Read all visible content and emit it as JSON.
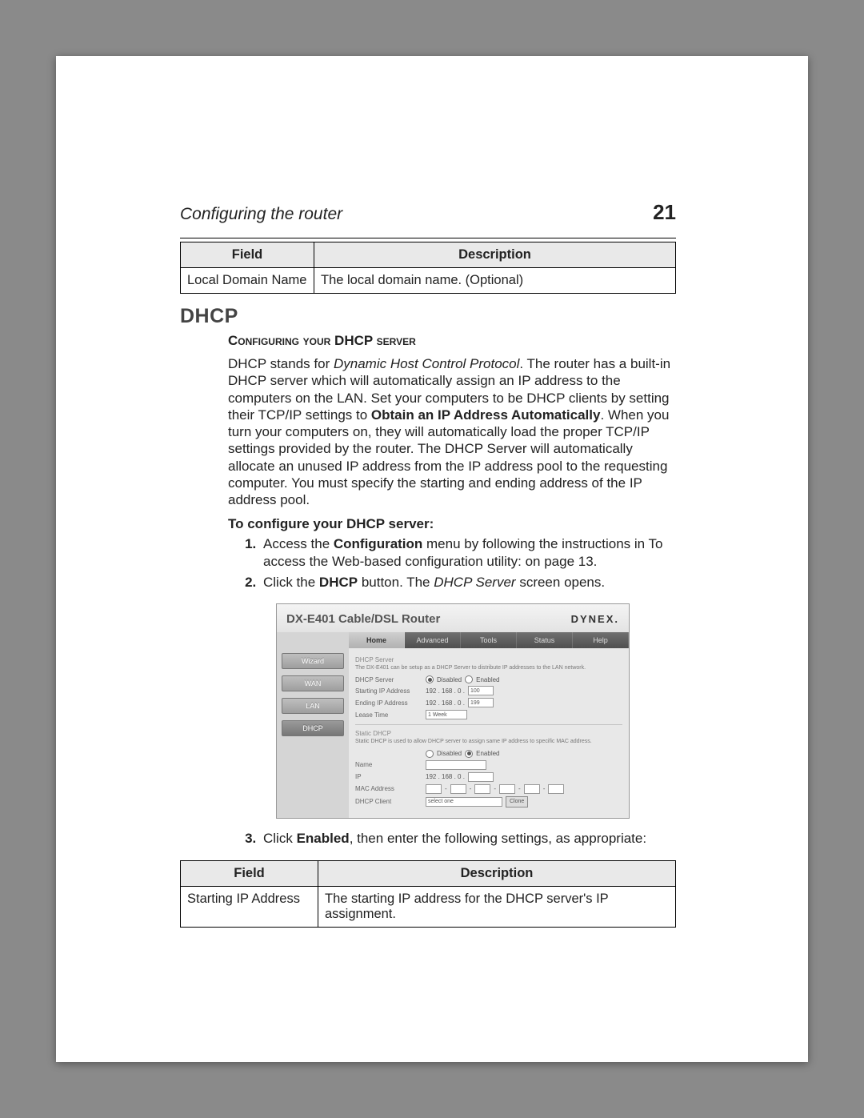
{
  "runhead": {
    "title": "Configuring the router",
    "page": "21"
  },
  "table1": {
    "headers": {
      "field": "Field",
      "description": "Description"
    },
    "rows": [
      {
        "field": "Local Domain Name",
        "description": "The local domain name. (Optional)"
      }
    ]
  },
  "section": {
    "heading": "DHCP",
    "subheading": "Configuring your DHCP server",
    "paragraph": {
      "lead": "DHCP stands for ",
      "italic": "Dynamic Host Control Protocol",
      "after_italic": ". The router has a built-in DHCP server which will automatically assign an IP address to the computers on the LAN. Set your computers to be DHCP clients by setting their TCP/IP settings to ",
      "bold1": "Obtain an IP Address Automatically",
      "after_bold1": ". When you turn your computers on, they will automatically load the proper TCP/IP settings provided by the router. The DHCP Server will automatically allocate an unused IP address from the IP address pool to the requesting computer. You must specify the starting and ending address of the IP address pool."
    },
    "to_configure": "To configure your DHCP server:",
    "steps": {
      "s1": {
        "pre": "Access the ",
        "b": "Configuration",
        "post": " menu by following the instructions in To access the Web-based configuration utility: on page 13."
      },
      "s2": {
        "pre": "Click the ",
        "b": "DHCP",
        "mid": " button. The ",
        "i": "DHCP Server",
        "post": " screen opens."
      },
      "s3": {
        "pre": "Click ",
        "b": "Enabled",
        "post": ", then enter the following settings, as appropriate:"
      }
    }
  },
  "router": {
    "title": "DX-E401 Cable/DSL  Router",
    "brand": "DYNEX.",
    "side": [
      "Wizard",
      "WAN",
      "LAN",
      "DHCP"
    ],
    "tabs": [
      "Home",
      "Advanced",
      "Tools",
      "Status",
      "Help"
    ],
    "sectionA": {
      "label": "DHCP Server",
      "desc": "The DX-E401 can be setup as a DHCP Server to distribute IP addresses to the LAN network.",
      "rows": {
        "dhcp_server": "DHCP Server",
        "disabled": "Disabled",
        "enabled": "Enabled",
        "start_ip_lbl": "Starting IP Address",
        "start_ip_pre": "192 . 168 . 0 .",
        "start_ip_val": "100",
        "end_ip_lbl": "Ending IP Address",
        "end_ip_pre": "192 . 168 . 0 .",
        "end_ip_val": "199",
        "lease_lbl": "Lease Time",
        "lease_val": "1 Week"
      }
    },
    "sectionB": {
      "label": "Static DHCP",
      "desc": "Static DHCP is used to allow DHCP server to assign same IP address to specific MAC address.",
      "rows": {
        "disabled": "Disabled",
        "enabled": "Enabled",
        "name_lbl": "Name",
        "ip_lbl": "IP",
        "ip_pre": "192 . 168 . 0 .",
        "mac_lbl": "MAC Address",
        "client_lbl": "DHCP Client",
        "client_sel": "select one",
        "clone_btn": "Clone"
      }
    }
  },
  "table2": {
    "headers": {
      "field": "Field",
      "description": "Description"
    },
    "rows": [
      {
        "field": "Starting IP Address",
        "description": "The starting IP address for the DHCP server's IP assignment."
      }
    ]
  }
}
